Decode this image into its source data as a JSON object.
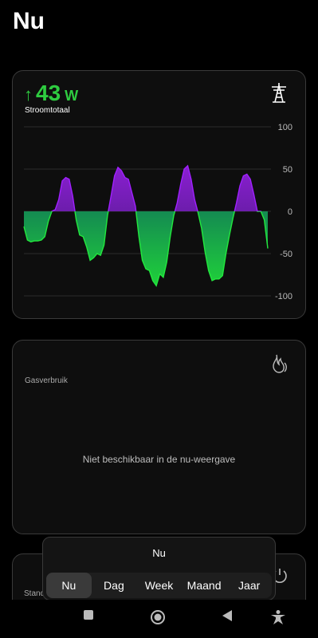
{
  "page": {
    "title": "Nu"
  },
  "power_card": {
    "direction_icon": "arrow-up-icon",
    "value": "43",
    "unit": "W",
    "label": "Stroomtotaal",
    "icon": "power-tower-icon",
    "accent": "#2ecc40"
  },
  "chart_data": {
    "type": "area",
    "title": "",
    "xlabel": "",
    "ylabel": "",
    "ylim": [
      -100,
      100
    ],
    "yticks": [
      100,
      50,
      0,
      -50,
      -100
    ],
    "colors": {
      "positive": "#8a1fd1",
      "negative": "#1fd13a"
    },
    "grid": true,
    "x": [
      0,
      1,
      2,
      3,
      4,
      5,
      6,
      7,
      8,
      9,
      10,
      11,
      12,
      13,
      14,
      15,
      16,
      17,
      18,
      19,
      20,
      21,
      22,
      23,
      24,
      25,
      26,
      27,
      28,
      29,
      30,
      31,
      32,
      33,
      34,
      35,
      36,
      37,
      38,
      39,
      40,
      41,
      42,
      43,
      44,
      45,
      46,
      47,
      48,
      49,
      50,
      51,
      52,
      53,
      54,
      55,
      56,
      57,
      58,
      59,
      60,
      61,
      62,
      63,
      64,
      65,
      66,
      67,
      68,
      69,
      70,
      71,
      72,
      73,
      74,
      75,
      76,
      77,
      78,
      79,
      80,
      81,
      82,
      83,
      84,
      85,
      86,
      87,
      88,
      89,
      90,
      91,
      92,
      93,
      94,
      95,
      96,
      97,
      98,
      99,
      100
    ],
    "values": [
      -18,
      -34,
      -36,
      -35,
      -35,
      -34,
      -30,
      -12,
      0,
      2,
      14,
      36,
      40,
      38,
      18,
      -10,
      -28,
      -30,
      -42,
      -58,
      -55,
      -50,
      -52,
      -40,
      -5,
      18,
      42,
      52,
      48,
      40,
      38,
      22,
      6,
      -30,
      -58,
      -68,
      -70,
      -82,
      -88,
      -74,
      -78,
      -60,
      -30,
      -5,
      10,
      32,
      50,
      54,
      38,
      14,
      -2,
      -20,
      -48,
      -70,
      -82,
      -80,
      -80,
      -76,
      -50,
      -28,
      -8,
      10,
      30,
      42,
      44,
      38,
      20,
      0,
      0,
      -10,
      -44
    ],
    "series": [
      {
        "values": []
      }
    ]
  },
  "gas_card": {
    "label": "Gasverbruik",
    "icon": "flame-icon",
    "message": "Niet beschikbaar in de nu-weergave"
  },
  "stand_card": {
    "label": "Stand",
    "icon": "power-button-icon"
  },
  "period_popup": {
    "title": "Nu",
    "options": [
      "Nu",
      "Dag",
      "Week",
      "Maand",
      "Jaar"
    ],
    "selected": "Nu"
  },
  "navbar": {
    "icons": [
      "square-icon",
      "home-circle-icon",
      "back-triangle-icon",
      "accessibility-icon"
    ]
  }
}
